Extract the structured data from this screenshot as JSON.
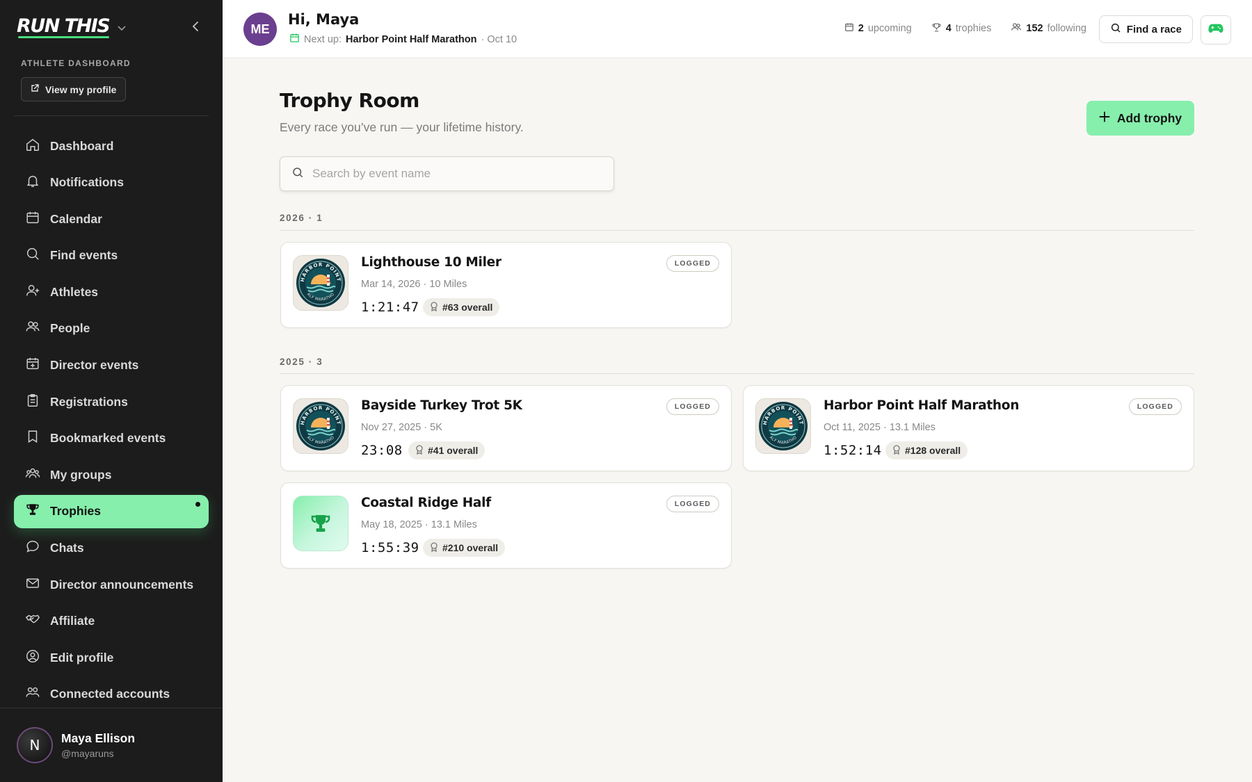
{
  "brand": {
    "name": "RUN THIS",
    "accent": "#4ade80"
  },
  "sidebar": {
    "section_label": "ATHLETE DASHBOARD",
    "profile_button": "View my profile",
    "items": [
      {
        "label": "Dashboard",
        "icon": "home-icon"
      },
      {
        "label": "Notifications",
        "icon": "bell-icon"
      },
      {
        "label": "Calendar",
        "icon": "calendar-icon"
      },
      {
        "label": "Find events",
        "icon": "search-icon"
      },
      {
        "label": "Athletes",
        "icon": "user-plus-icon"
      },
      {
        "label": "People",
        "icon": "users-icon"
      },
      {
        "label": "Director events",
        "icon": "calendar-plus-icon"
      },
      {
        "label": "Registrations",
        "icon": "clipboard-icon"
      },
      {
        "label": "Bookmarked events",
        "icon": "bookmark-icon"
      },
      {
        "label": "My groups",
        "icon": "group-icon"
      },
      {
        "label": "Trophies",
        "icon": "trophy-icon",
        "active": true
      },
      {
        "label": "Chats",
        "icon": "chat-icon"
      },
      {
        "label": "Director announcements",
        "icon": "mail-icon"
      },
      {
        "label": "Affiliate",
        "icon": "handshake-icon"
      },
      {
        "label": "Edit profile",
        "icon": "user-circle-icon"
      },
      {
        "label": "Connected accounts",
        "icon": "users-link-icon"
      }
    ],
    "user": {
      "initial": "N",
      "name": "Maya Ellison",
      "handle": "@mayaruns"
    }
  },
  "header": {
    "avatar_initials": "ME",
    "greeting": "Hi, Maya",
    "next_up_label": "Next up:",
    "next_up_event": "Harbor Point Half Marathon",
    "next_up_date": "· Oct 10",
    "stats": {
      "upcoming_count": "2",
      "upcoming_label": "upcoming",
      "trophies_count": "4",
      "trophies_label": "trophies",
      "following_count": "152",
      "following_label": "following"
    },
    "find_race_label": "Find a race"
  },
  "main": {
    "title": "Trophy Room",
    "subtitle": "Every race you’ve run — your lifetime history.",
    "add_button": "Add trophy",
    "search_placeholder": "Search by event name",
    "groups": [
      {
        "label": "2026 · 1",
        "trophies": [
          {
            "title": "Lighthouse 10 Miler",
            "meta": "Mar 14, 2026 · 10 Miles",
            "time": "1:21:47",
            "rank": "#63 overall",
            "status": "LOGGED",
            "badge": "harbor-point-badge"
          }
        ]
      },
      {
        "label": "2025 · 3",
        "trophies": [
          {
            "title": "Bayside Turkey Trot 5K",
            "meta": "Nov 27, 2025 · 5K",
            "time": "23:08",
            "rank": "#41 overall",
            "status": "LOGGED",
            "badge": "harbor-point-badge"
          },
          {
            "title": "Harbor Point Half Marathon",
            "meta": "Oct 11, 2025 · 13.1 Miles",
            "time": "1:52:14",
            "rank": "#128 overall",
            "status": "LOGGED",
            "badge": "harbor-point-badge"
          },
          {
            "title": "Coastal Ridge Half",
            "meta": "May 18, 2025 · 13.1 Miles",
            "time": "1:55:39",
            "rank": "#210 overall",
            "status": "LOGGED",
            "badge": "trophy-badge"
          }
        ]
      }
    ]
  }
}
